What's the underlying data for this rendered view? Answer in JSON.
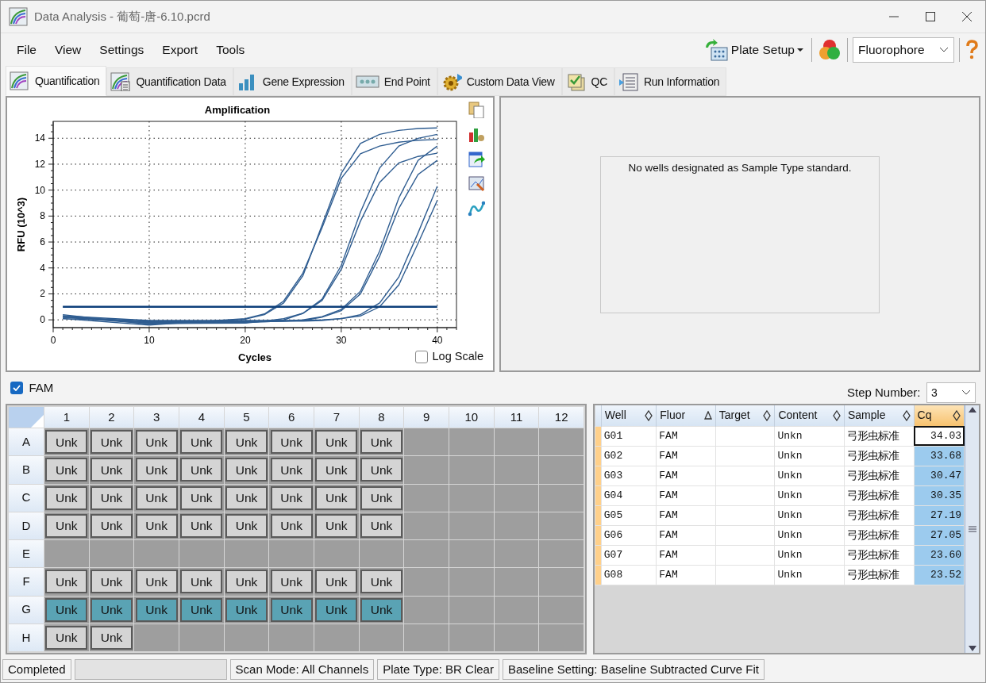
{
  "window": {
    "title": "Data Analysis - 葡萄-唐-6.10.pcrd"
  },
  "menu": [
    "File",
    "View",
    "Settings",
    "Export",
    "Tools"
  ],
  "toolbar": {
    "plate_setup": "Plate Setup",
    "fluor_select": "Fluorophore"
  },
  "tabs": [
    {
      "label": "Quantification",
      "selected": true
    },
    {
      "label": "Quantification Data",
      "selected": false
    },
    {
      "label": "Gene Expression",
      "selected": false
    },
    {
      "label": "End Point",
      "selected": false
    },
    {
      "label": "Custom Data View",
      "selected": false
    },
    {
      "label": "QC",
      "selected": false
    },
    {
      "label": "Run Information",
      "selected": false
    }
  ],
  "chart": {
    "log_scale": false,
    "chart_data": {
      "type": "line",
      "title": "Amplification",
      "xlabel": "Cycles",
      "ylabel": "RFU (10^3)",
      "x": [
        1,
        10,
        20,
        22,
        24,
        26,
        28,
        30,
        32,
        34,
        36,
        38,
        40
      ],
      "xlim": [
        0,
        42
      ],
      "ylim": [
        -0.6,
        15.3
      ],
      "xticks": [
        0,
        10,
        20,
        30,
        40
      ],
      "yticks": [
        0,
        2,
        4,
        6,
        8,
        10,
        12,
        14
      ],
      "grid": true,
      "series": [
        {
          "color": "#2f5d91",
          "values": [
            0.2,
            -0.1,
            -0.1,
            -0.1,
            -0.1,
            -0.1,
            -0.05,
            0.1,
            0.3,
            1.0,
            2.7,
            5.9,
            9.2
          ]
        },
        {
          "color": "#2f5d91",
          "values": [
            0.3,
            -0.05,
            -0.05,
            -0.05,
            -0.05,
            -0.05,
            0,
            0.1,
            0.4,
            1.3,
            3.3,
            6.7,
            10.3
          ]
        },
        {
          "color": "#2f5d91",
          "values": [
            0.1,
            -0.15,
            -0.15,
            -0.15,
            -0.1,
            -0.05,
            0.2,
            0.7,
            2.0,
            4.9,
            8.6,
            11.2,
            12.3
          ]
        },
        {
          "color": "#2f5d91",
          "values": [
            0.2,
            -0.2,
            -0.2,
            -0.15,
            -0.1,
            0,
            0.25,
            0.8,
            2.2,
            5.3,
            9.4,
            12.3,
            13.4
          ]
        },
        {
          "color": "#2f5d91",
          "values": [
            0.3,
            -0.25,
            -0.2,
            -0.1,
            0,
            0.5,
            1.5,
            3.9,
            7.6,
            10.6,
            12.1,
            12.6,
            12.85
          ]
        },
        {
          "color": "#2f5d91",
          "values": [
            0.2,
            -0.3,
            -0.25,
            -0.1,
            0.1,
            0.5,
            1.6,
            4.2,
            8.3,
            11.7,
            13.4,
            14.0,
            14.3
          ]
        },
        {
          "color": "#2f5d91",
          "values": [
            0.4,
            -0.35,
            0.05,
            0.4,
            1.3,
            3.4,
            7.3,
            11.3,
            13.6,
            14.3,
            14.6,
            14.75,
            14.8
          ]
        },
        {
          "color": "#2f5d91",
          "values": [
            0.1,
            -0.4,
            0.1,
            0.45,
            1.45,
            3.6,
            7.1,
            10.9,
            12.8,
            13.4,
            13.7,
            13.85,
            13.9
          ]
        },
        {
          "color": "#0d3f7a",
          "values": [
            1.0,
            1.0,
            1.0,
            1.0,
            1.0,
            1.0,
            1.0,
            1.0,
            1.0,
            1.0,
            1.0,
            1.0,
            1.0
          ]
        }
      ]
    },
    "log_label": "Log Scale"
  },
  "standard_panel": {
    "message": "No wells designated as Sample Type standard."
  },
  "fluor_filter": {
    "label": "FAM",
    "checked": true
  },
  "step": {
    "label": "Step Number:",
    "value": "3"
  },
  "plate": {
    "columns": [
      "1",
      "2",
      "3",
      "4",
      "5",
      "6",
      "7",
      "8",
      "9",
      "10",
      "11",
      "12"
    ],
    "rows": [
      {
        "label": "A",
        "wells": [
          {
            "kind": "sample",
            "text": "Unk",
            "selected": false
          },
          {
            "kind": "sample",
            "text": "Unk",
            "selected": false
          },
          {
            "kind": "sample",
            "text": "Unk",
            "selected": false
          },
          {
            "kind": "sample",
            "text": "Unk",
            "selected": false
          },
          {
            "kind": "sample",
            "text": "Unk",
            "selected": false
          },
          {
            "kind": "sample",
            "text": "Unk",
            "selected": false
          },
          {
            "kind": "sample",
            "text": "Unk",
            "selected": false
          },
          {
            "kind": "sample",
            "text": "Unk",
            "selected": false
          },
          {
            "kind": "empty"
          },
          {
            "kind": "empty"
          },
          {
            "kind": "empty"
          },
          {
            "kind": "empty"
          }
        ]
      },
      {
        "label": "B",
        "wells": [
          {
            "kind": "sample",
            "text": "Unk",
            "selected": false
          },
          {
            "kind": "sample",
            "text": "Unk",
            "selected": false
          },
          {
            "kind": "sample",
            "text": "Unk",
            "selected": false
          },
          {
            "kind": "sample",
            "text": "Unk",
            "selected": false
          },
          {
            "kind": "sample",
            "text": "Unk",
            "selected": false
          },
          {
            "kind": "sample",
            "text": "Unk",
            "selected": false
          },
          {
            "kind": "sample",
            "text": "Unk",
            "selected": false
          },
          {
            "kind": "sample",
            "text": "Unk",
            "selected": false
          },
          {
            "kind": "empty"
          },
          {
            "kind": "empty"
          },
          {
            "kind": "empty"
          },
          {
            "kind": "empty"
          }
        ]
      },
      {
        "label": "C",
        "wells": [
          {
            "kind": "sample",
            "text": "Unk",
            "selected": false
          },
          {
            "kind": "sample",
            "text": "Unk",
            "selected": false
          },
          {
            "kind": "sample",
            "text": "Unk",
            "selected": false
          },
          {
            "kind": "sample",
            "text": "Unk",
            "selected": false
          },
          {
            "kind": "sample",
            "text": "Unk",
            "selected": false
          },
          {
            "kind": "sample",
            "text": "Unk",
            "selected": false
          },
          {
            "kind": "sample",
            "text": "Unk",
            "selected": false
          },
          {
            "kind": "sample",
            "text": "Unk",
            "selected": false
          },
          {
            "kind": "empty"
          },
          {
            "kind": "empty"
          },
          {
            "kind": "empty"
          },
          {
            "kind": "empty"
          }
        ]
      },
      {
        "label": "D",
        "wells": [
          {
            "kind": "sample",
            "text": "Unk",
            "selected": false
          },
          {
            "kind": "sample",
            "text": "Unk",
            "selected": false
          },
          {
            "kind": "sample",
            "text": "Unk",
            "selected": false
          },
          {
            "kind": "sample",
            "text": "Unk",
            "selected": false
          },
          {
            "kind": "sample",
            "text": "Unk",
            "selected": false
          },
          {
            "kind": "sample",
            "text": "Unk",
            "selected": false
          },
          {
            "kind": "sample",
            "text": "Unk",
            "selected": false
          },
          {
            "kind": "sample",
            "text": "Unk",
            "selected": false
          },
          {
            "kind": "empty"
          },
          {
            "kind": "empty"
          },
          {
            "kind": "empty"
          },
          {
            "kind": "empty"
          }
        ]
      },
      {
        "label": "E",
        "wells": [
          {
            "kind": "empty"
          },
          {
            "kind": "empty"
          },
          {
            "kind": "empty"
          },
          {
            "kind": "empty"
          },
          {
            "kind": "empty"
          },
          {
            "kind": "empty"
          },
          {
            "kind": "empty"
          },
          {
            "kind": "empty"
          },
          {
            "kind": "empty"
          },
          {
            "kind": "empty"
          },
          {
            "kind": "empty"
          },
          {
            "kind": "empty"
          }
        ]
      },
      {
        "label": "F",
        "wells": [
          {
            "kind": "sample",
            "text": "Unk",
            "selected": false
          },
          {
            "kind": "sample",
            "text": "Unk",
            "selected": false
          },
          {
            "kind": "sample",
            "text": "Unk",
            "selected": false
          },
          {
            "kind": "sample",
            "text": "Unk",
            "selected": false
          },
          {
            "kind": "sample",
            "text": "Unk",
            "selected": false
          },
          {
            "kind": "sample",
            "text": "Unk",
            "selected": false
          },
          {
            "kind": "sample",
            "text": "Unk",
            "selected": false
          },
          {
            "kind": "sample",
            "text": "Unk",
            "selected": false
          },
          {
            "kind": "empty"
          },
          {
            "kind": "empty"
          },
          {
            "kind": "empty"
          },
          {
            "kind": "empty"
          }
        ]
      },
      {
        "label": "G",
        "wells": [
          {
            "kind": "sample",
            "text": "Unk",
            "selected": true
          },
          {
            "kind": "sample",
            "text": "Unk",
            "selected": true
          },
          {
            "kind": "sample",
            "text": "Unk",
            "selected": true
          },
          {
            "kind": "sample",
            "text": "Unk",
            "selected": true
          },
          {
            "kind": "sample",
            "text": "Unk",
            "selected": true
          },
          {
            "kind": "sample",
            "text": "Unk",
            "selected": true
          },
          {
            "kind": "sample",
            "text": "Unk",
            "selected": true
          },
          {
            "kind": "sample",
            "text": "Unk",
            "selected": true
          },
          {
            "kind": "empty"
          },
          {
            "kind": "empty"
          },
          {
            "kind": "empty"
          },
          {
            "kind": "empty"
          }
        ]
      },
      {
        "label": "H",
        "wells": [
          {
            "kind": "sample",
            "text": "Unk",
            "selected": false
          },
          {
            "kind": "sample",
            "text": "Unk",
            "selected": false
          },
          {
            "kind": "empty"
          },
          {
            "kind": "empty"
          },
          {
            "kind": "empty"
          },
          {
            "kind": "empty"
          },
          {
            "kind": "empty"
          },
          {
            "kind": "empty"
          },
          {
            "kind": "empty"
          },
          {
            "kind": "empty"
          },
          {
            "kind": "empty"
          },
          {
            "kind": "empty"
          }
        ]
      }
    ]
  },
  "table": {
    "columns": [
      {
        "label": "Well",
        "sorted": false,
        "selected": false
      },
      {
        "label": "Fluor",
        "sorted": true,
        "selected": false
      },
      {
        "label": "Target",
        "sorted": false,
        "selected": false
      },
      {
        "label": "Content",
        "sorted": false,
        "selected": false
      },
      {
        "label": "Sample",
        "sorted": false,
        "selected": false
      },
      {
        "label": "Cq",
        "sorted": false,
        "selected": true
      }
    ],
    "rows": [
      {
        "cells": [
          "G01",
          "FAM",
          "",
          "Unkn",
          "弓形虫标准",
          "34.03"
        ],
        "selected": true
      },
      {
        "cells": [
          "G02",
          "FAM",
          "",
          "Unkn",
          "弓形虫标准",
          "33.68"
        ],
        "selected": false
      },
      {
        "cells": [
          "G03",
          "FAM",
          "",
          "Unkn",
          "弓形虫标准",
          "30.47"
        ],
        "selected": false
      },
      {
        "cells": [
          "G04",
          "FAM",
          "",
          "Unkn",
          "弓形虫标准",
          "30.35"
        ],
        "selected": false
      },
      {
        "cells": [
          "G05",
          "FAM",
          "",
          "Unkn",
          "弓形虫标准",
          "27.19"
        ],
        "selected": false
      },
      {
        "cells": [
          "G06",
          "FAM",
          "",
          "Unkn",
          "弓形虫标准",
          "27.05"
        ],
        "selected": false
      },
      {
        "cells": [
          "G07",
          "FAM",
          "",
          "Unkn",
          "弓形虫标准",
          "23.60"
        ],
        "selected": false
      },
      {
        "cells": [
          "G08",
          "FAM",
          "",
          "Unkn",
          "弓形虫标准",
          "23.52"
        ],
        "selected": false
      }
    ]
  },
  "status_bar": [
    {
      "kind": "text",
      "text": "Completed"
    },
    {
      "kind": "blank"
    },
    {
      "kind": "text",
      "text": "Scan Mode: All Channels"
    },
    {
      "kind": "text",
      "text": "Plate Type: BR Clear"
    },
    {
      "kind": "text",
      "text": "Baseline Setting: Baseline Subtracted Curve Fit"
    }
  ]
}
